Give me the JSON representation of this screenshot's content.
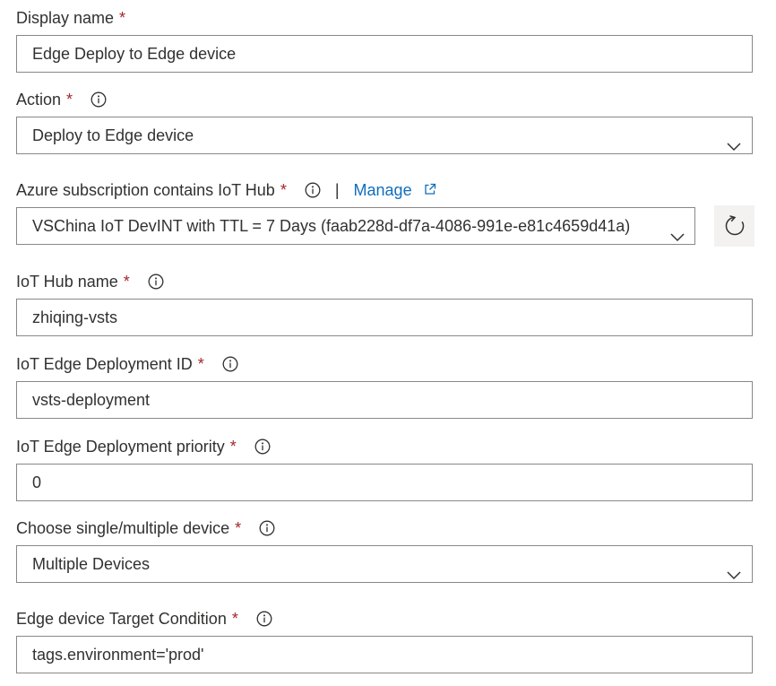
{
  "form": {
    "required_marker": "*",
    "display_name": {
      "label": "Display name",
      "value": "Edge Deploy to Edge device"
    },
    "action": {
      "label": "Action",
      "value": "Deploy to Edge device"
    },
    "subscription": {
      "label": "Azure subscription contains IoT Hub",
      "separator": "|",
      "manage_label": "Manage",
      "value": "VSChina IoT DevINT with TTL = 7 Days (faab228d-df7a-4086-991e-e81c4659d41a)"
    },
    "iot_hub_name": {
      "label": "IoT Hub name",
      "value": "zhiqing-vsts"
    },
    "deployment_id": {
      "label": "IoT Edge Deployment ID",
      "value": "vsts-deployment"
    },
    "deployment_priority": {
      "label": "IoT Edge Deployment priority",
      "value": "0"
    },
    "device_choice": {
      "label": "Choose single/multiple device",
      "value": "Multiple Devices"
    },
    "target_condition": {
      "label": "Edge device Target Condition",
      "value": "tags.environment='prod'"
    }
  },
  "icons": {
    "info": "info-icon",
    "chevron": "chevron-down-icon",
    "external_link": "external-link-icon",
    "refresh": "refresh-icon"
  },
  "colors": {
    "required": "#a4262c",
    "link": "#106ebe",
    "border": "#8a8886",
    "text": "#323130",
    "button_bg": "#f3f2f1"
  }
}
